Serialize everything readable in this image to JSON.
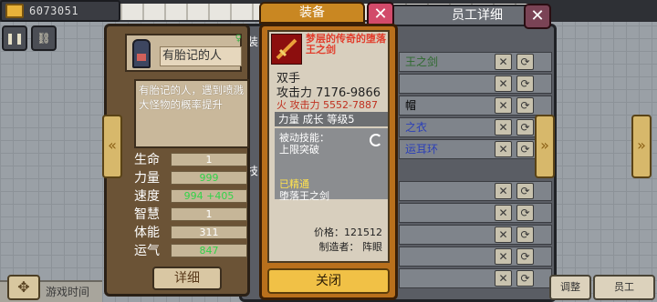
{
  "gold": {
    "amount": "6073051"
  },
  "character": {
    "name": "有胎记的人",
    "description": "有胎记的人，遇到喷溅大怪物的概率提升",
    "stats": [
      {
        "label": "生命",
        "value": "1",
        "color": "#ffffff"
      },
      {
        "label": "力量",
        "value": "999",
        "color": "#33d34a"
      },
      {
        "label": "速度",
        "value": "994 +405",
        "color": "#33d34a"
      },
      {
        "label": "智慧",
        "value": "1",
        "color": "#ffffff"
      },
      {
        "label": "体能",
        "value": "311",
        "color": "#ffffff"
      },
      {
        "label": "运气",
        "value": "847",
        "color": "#33d34a"
      }
    ],
    "detail_button": "详细"
  },
  "list_panel": {
    "header": "员工详细",
    "sections": {
      "equip": "装",
      "skill": "技"
    },
    "rows": [
      {
        "text": "王之剑",
        "color": "#2f6a2f"
      },
      {
        "text": "",
        "color": "#333333"
      },
      {
        "text": "帽",
        "color": "#333333"
      },
      {
        "text": "之衣",
        "color": "#2b3fb8"
      },
      {
        "text": "运耳环",
        "color": "#2b3fb8"
      },
      {
        "text": "",
        "color": "#333333"
      },
      {
        "text": "",
        "color": "#333333"
      },
      {
        "text": "",
        "color": "#333333"
      },
      {
        "text": "",
        "color": "#333333"
      },
      {
        "text": "",
        "color": "#333333"
      }
    ]
  },
  "modal": {
    "title": "装备",
    "item_name": "梦层的传奇的堕落王之剑",
    "slot": "双手",
    "attack": "攻击力 7176-9866",
    "fire_attack": "火 攻击力 5552-7887",
    "level_line": "力量 成长 等级5",
    "passive_label": "被动技能：",
    "passive_skill": "上限突破",
    "mastered": "已精通",
    "mastered_name": "堕落王之剑",
    "price": "价格：121512",
    "maker": "制造者： 阵眼",
    "close_button": "关闭"
  },
  "bottom": {
    "game_time_label": "游戏时间",
    "right_buttons": [
      "调整",
      "员工"
    ]
  },
  "icons": {
    "pause": "pause-icon",
    "settings": "link-icon",
    "close": "close-icon"
  }
}
